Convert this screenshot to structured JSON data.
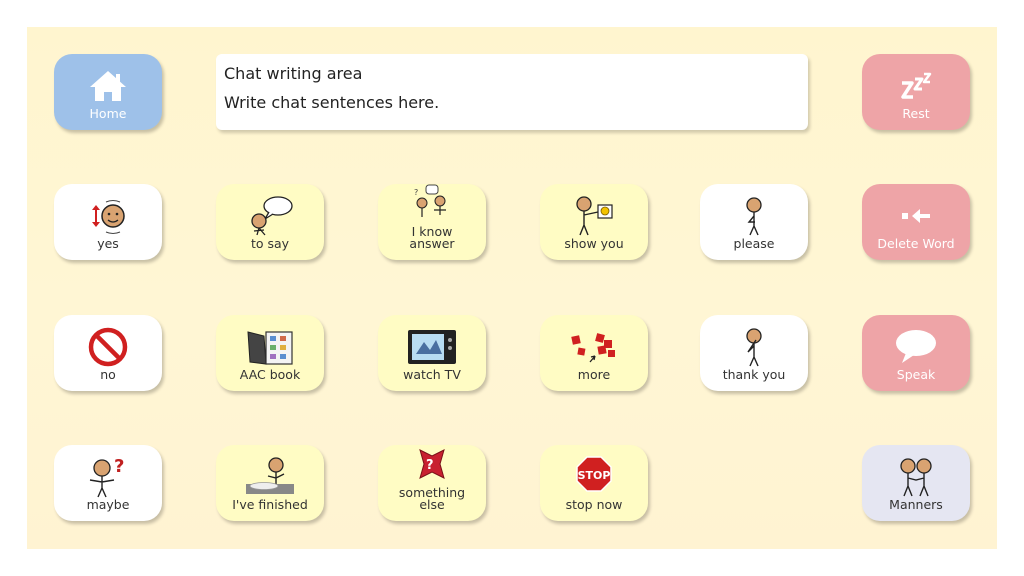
{
  "chat": {
    "title": "Chat writing area",
    "hint": "Write chat sentences here."
  },
  "nav": {
    "home": "Home",
    "rest": "Rest",
    "delete_word": "Delete Word",
    "speak": "Speak",
    "manners": "Manners"
  },
  "cells": {
    "yes": "yes",
    "to_say": "to say",
    "i_know_answer": "I know\nanswer",
    "show_you": "show you",
    "please": "please",
    "no": "no",
    "aac_book": "AAC book",
    "watch_tv": "watch TV",
    "more": "more",
    "thank_you": "thank you",
    "maybe": "maybe",
    "ive_finished": "I've finished",
    "something_else": "something\nelse",
    "stop_now": "stop now"
  },
  "stop_sign_text": "STOP",
  "colors": {
    "board": "#fff5cf",
    "yellow_tile": "#fffcc4",
    "blue_tile": "#9ec1e9",
    "red_tile": "#eea4a7",
    "lilac_tile": "#e5e6f2",
    "skin": "#d9a371"
  }
}
